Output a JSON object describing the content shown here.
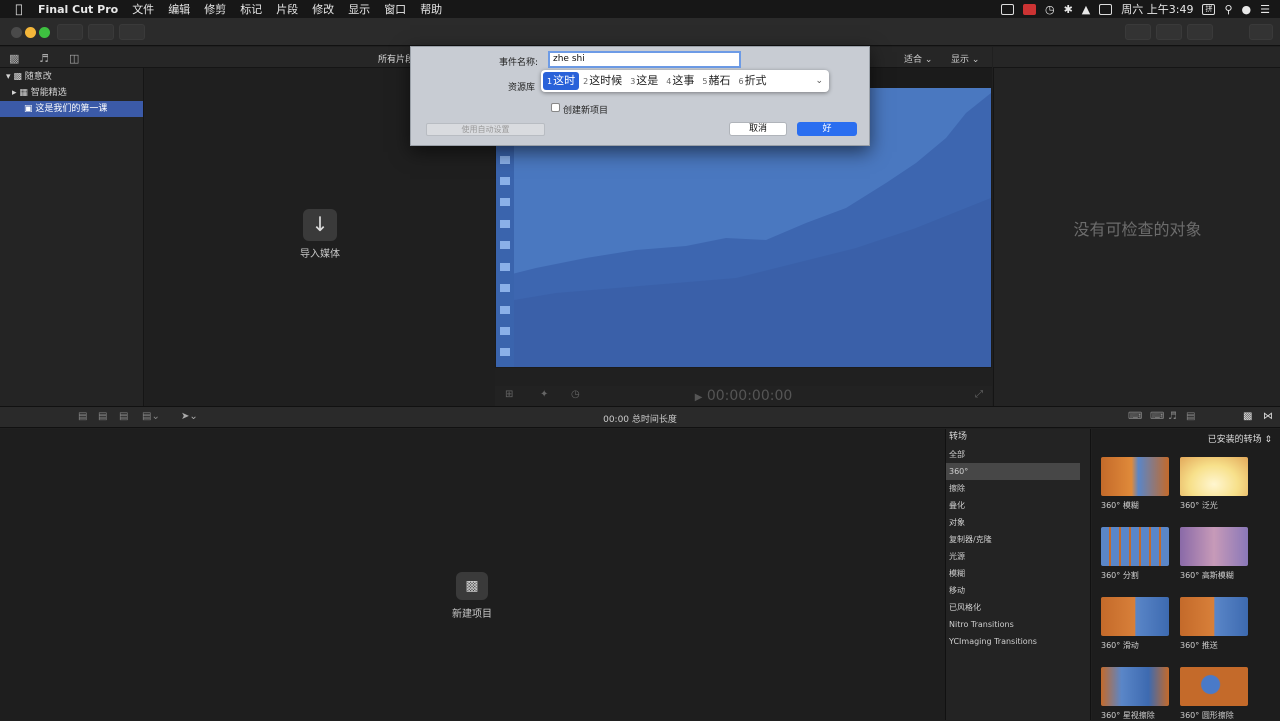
{
  "menubar": {
    "app_name": "Final Cut Pro",
    "items": [
      "文件",
      "编辑",
      "修剪",
      "标记",
      "片段",
      "修改",
      "显示",
      "窗口",
      "帮助"
    ],
    "clock": "周六 上午3:49",
    "input_method": "拼"
  },
  "browser": {
    "header_title": "所有片段",
    "import_label": "导入媒体"
  },
  "sidebar": {
    "library": "随意改",
    "smart": "智能精选",
    "event": "这是我们的第一课"
  },
  "viewer": {
    "fit": "适合",
    "display": "显示",
    "timecode": "00:00:00:00"
  },
  "inspector": {
    "empty_text": "没有可检查的对象"
  },
  "timeline": {
    "duration": "00:00 总时间长度",
    "new_project_label": "新建项目"
  },
  "transitions": {
    "header": "转场",
    "installed": "已安装的转场",
    "categories": [
      "全部",
      "360°",
      "擦除",
      "叠化",
      "对象",
      "复制器/克隆",
      "光源",
      "模糊",
      "移动",
      "已风格化",
      "Nitro Transitions",
      "YCImaging Transitions"
    ],
    "selected_category": "360°",
    "items": [
      "360° 模糊",
      "360° 泛光",
      "360° 分割",
      "360° 高斯模糊",
      "360° 滑动",
      "360° 推送",
      "360° 星视擦除",
      "360° 圆形擦除"
    ]
  },
  "dialog": {
    "event_name_label": "事件名称:",
    "event_name_value": "zhe shi",
    "library_label": "资源库",
    "candidates": [
      {
        "n": "1",
        "text": "这时"
      },
      {
        "n": "2",
        "text": "这时候"
      },
      {
        "n": "3",
        "text": "这是"
      },
      {
        "n": "4",
        "text": "这事"
      },
      {
        "n": "5",
        "text": "赭石"
      },
      {
        "n": "6",
        "text": "折式"
      }
    ],
    "create_project": "创建新项目",
    "auto_settings": "使用自动设置",
    "cancel": "取消",
    "ok": "好"
  },
  "colors": {
    "accent": "#2a6ef0",
    "selection": "#3b5aa8",
    "video_blue": "#3d6ab0"
  }
}
